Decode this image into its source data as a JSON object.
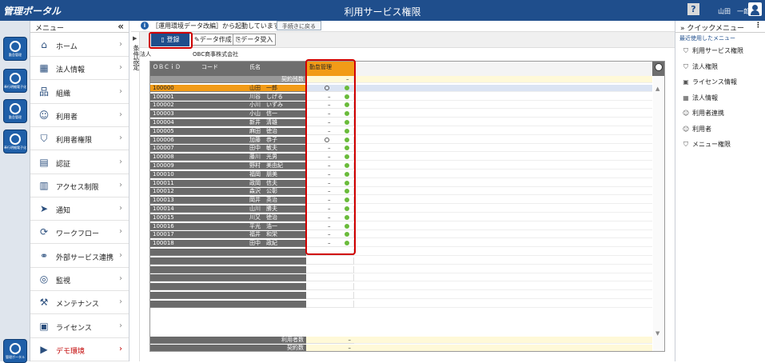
{
  "header": {
    "logo": "管理ポータル",
    "title": "利用サービス権限",
    "help": "?",
    "user": "山田　一郎"
  },
  "rail": [
    {
      "label": "勤怠管理"
    },
    {
      "label": "奉行明細電子化"
    },
    {
      "label": "勤怠管理"
    },
    {
      "label": "奉行明細電子化"
    },
    {
      "label": "管理ポータル"
    }
  ],
  "menu": {
    "title": "メニュー",
    "collapse": "«",
    "items": [
      {
        "label": "ホーム",
        "icon": "⌂"
      },
      {
        "label": "法人情報",
        "icon": "▦"
      },
      {
        "label": "組織",
        "icon": "品"
      },
      {
        "label": "利用者",
        "icon": "☺"
      },
      {
        "label": "利用者権限",
        "icon": "⛉"
      },
      {
        "label": "認証",
        "icon": "▤"
      },
      {
        "label": "アクセス制限",
        "icon": "▥"
      },
      {
        "label": "通知",
        "icon": "➤"
      },
      {
        "label": "ワークフロー",
        "icon": "⟳"
      },
      {
        "label": "外部サービス連携",
        "icon": "⚭"
      },
      {
        "label": "監視",
        "icon": "◎"
      },
      {
        "label": "メンテナンス",
        "icon": "⚒"
      },
      {
        "label": "ライセンス",
        "icon": "▣"
      },
      {
        "label": "デモ環境",
        "icon": "▶"
      }
    ],
    "chevron": "›"
  },
  "info": {
    "icon": "i",
    "text": "［運用環境データ改編］から起動しています",
    "back": "手続きに戻る"
  },
  "side_strip": {
    "arrow": "▶",
    "label": "条件設定"
  },
  "toolbar": {
    "register": "登録",
    "create": "データ作成",
    "import": "データ受入"
  },
  "corp": {
    "label": "法人",
    "name": "OBC商事株式会社"
  },
  "grid": {
    "headers": {
      "obcid": "ＯＢＣｉＤ",
      "code": "コード",
      "name": "氏名",
      "module": "勤怠管理"
    },
    "count_row": {
      "label": "契約残数",
      "value": "–"
    },
    "rows": [
      {
        "id": "100000",
        "name": "山田　一郎",
        "v": "○",
        "ok": true,
        "selected": true
      },
      {
        "id": "100001",
        "name": "川谷　しげる",
        "v": "–",
        "ok": true
      },
      {
        "id": "100002",
        "name": "小川　いずみ",
        "v": "–",
        "ok": true
      },
      {
        "id": "100003",
        "name": "小山　信一",
        "v": "–",
        "ok": true
      },
      {
        "id": "100004",
        "name": "新井　清雄",
        "v": "–",
        "ok": true
      },
      {
        "id": "100005",
        "name": "麻田　徳治",
        "v": "–",
        "ok": true
      },
      {
        "id": "100006",
        "name": "加藤　恭子",
        "v": "○",
        "ok": true
      },
      {
        "id": "100007",
        "name": "田中　敏夫",
        "v": "–",
        "ok": true
      },
      {
        "id": "100008",
        "name": "藤川　光男",
        "v": "–",
        "ok": true
      },
      {
        "id": "100009",
        "name": "野村　美由紀",
        "v": "–",
        "ok": true
      },
      {
        "id": "100010",
        "name": "福岡　朋美",
        "v": "–",
        "ok": true
      },
      {
        "id": "100011",
        "name": "政岡　信夫",
        "v": "–",
        "ok": true
      },
      {
        "id": "100012",
        "name": "森沢　公彰",
        "v": "–",
        "ok": true
      },
      {
        "id": "100013",
        "name": "岡井　英治",
        "v": "–",
        "ok": true
      },
      {
        "id": "100014",
        "name": "山川　勝夫",
        "v": "–",
        "ok": true
      },
      {
        "id": "100015",
        "name": "川又　徳治",
        "v": "–",
        "ok": true
      },
      {
        "id": "100016",
        "name": "平光　浩一",
        "v": "–",
        "ok": true
      },
      {
        "id": "100017",
        "name": "福井　和栄",
        "v": "–",
        "ok": true
      },
      {
        "id": "100018",
        "name": "田中　政紀",
        "v": "–",
        "ok": true
      }
    ],
    "footer": [
      {
        "label": "利用者数",
        "value": "–"
      },
      {
        "label": "契約数",
        "value": "–"
      }
    ]
  },
  "quick": {
    "title": "クイックメニュー",
    "recent": "最近使用したメニュー",
    "items": [
      {
        "label": "利用サービス権限",
        "icon": "⛉"
      },
      {
        "label": "法人権限",
        "icon": "⛉"
      },
      {
        "label": "ライセンス情報",
        "icon": "▣"
      },
      {
        "label": "法人情報",
        "icon": "▦"
      },
      {
        "label": "利用者連携",
        "icon": "☺"
      },
      {
        "label": "利用者",
        "icon": "☺"
      },
      {
        "label": "メニュー権限",
        "icon": "⛉"
      }
    ]
  },
  "colors": {
    "header": "#1f4e8c",
    "accent": "#f29b17",
    "highlight": "#d00000",
    "ok": "#6abb3b"
  }
}
